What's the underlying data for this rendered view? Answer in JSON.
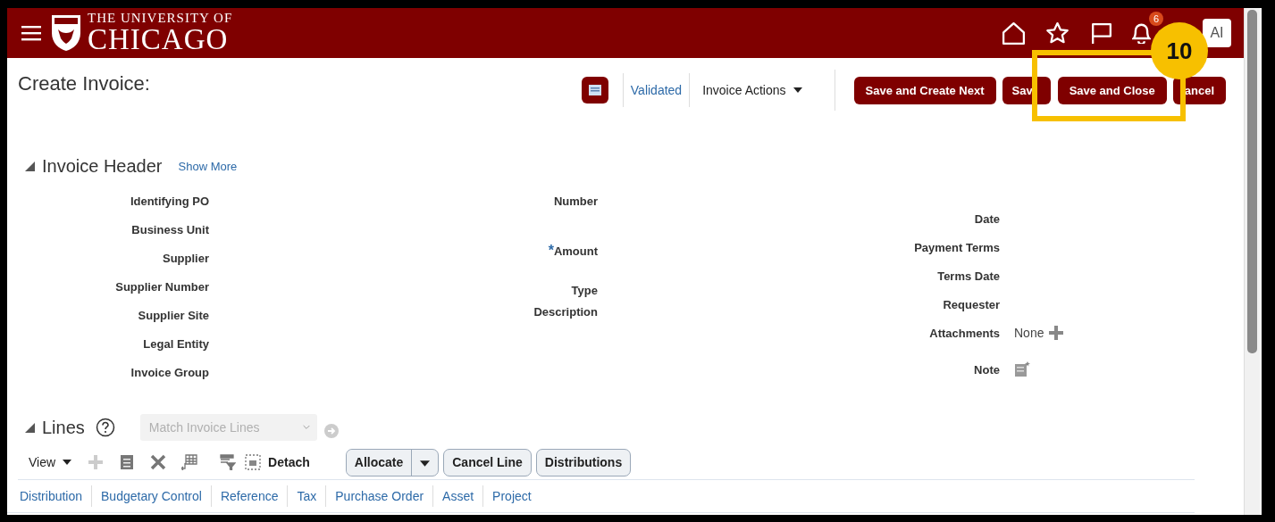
{
  "header": {
    "brand_top": "THE UNIVERSITY OF",
    "brand_main": "CHICAGO",
    "notification_count": "6",
    "avatar": "AI"
  },
  "page": {
    "title": "Create Invoice:",
    "status": "Validated",
    "actions_menu": "Invoice Actions",
    "buttons": [
      {
        "label": "Save and Create Next"
      },
      {
        "label": "Sav"
      },
      {
        "label": "Save and Close"
      },
      {
        "label": "ancel"
      }
    ]
  },
  "callout": {
    "number": "10"
  },
  "invoice_header": {
    "title": "Invoice Header",
    "expanded": true,
    "link": "Show More",
    "columns": [
      [
        {
          "label": "Identifying PO",
          "kind": "text"
        },
        {
          "label": "Business Unit",
          "kind": "text"
        },
        {
          "label": "Supplier",
          "kind": "text"
        },
        {
          "label": "Supplier Number",
          "kind": "text"
        },
        {
          "label": "Supplier Site",
          "kind": "text"
        },
        {
          "label": "Legal Entity",
          "kind": "text"
        },
        {
          "label": "Invoice Group",
          "kind": "text"
        }
      ],
      [
        {
          "label": "Number",
          "kind": "text"
        },
        {
          "label": "Amount",
          "marker": "*",
          "kind": "text"
        },
        {
          "label": "Type",
          "kind": "text"
        },
        {
          "label": "Description",
          "kind": "text"
        }
      ],
      [
        {
          "label": "Date",
          "kind": "text"
        },
        {
          "label": "Payment Terms",
          "kind": "text"
        },
        {
          "label": "Terms Date",
          "kind": "text"
        },
        {
          "label": "Requester",
          "kind": "text"
        },
        {
          "label": "Attachments",
          "kind": "attachments",
          "value": "None"
        },
        {
          "label": "Note",
          "kind": "note"
        }
      ]
    ]
  },
  "lines": {
    "title": "Lines",
    "expanded": true,
    "match_placeholder": "Match Invoice Lines",
    "view_menu": "View",
    "tools": [
      {
        "kind": "add",
        "disabled": true
      },
      {
        "kind": "copy",
        "disabled": false
      },
      {
        "kind": "delete",
        "disabled": false
      },
      {
        "kind": "split",
        "disabled": false
      },
      {
        "kind": "filter",
        "disabled": false
      },
      {
        "kind": "detach",
        "disabled": false,
        "label": "Detach"
      }
    ],
    "buttons": [
      {
        "label": "Allocate",
        "kind": "split"
      },
      {
        "label": "Cancel Line",
        "kind": "plain"
      },
      {
        "label": "Distributions",
        "kind": "plain"
      }
    ],
    "tabs": [
      "Distribution",
      "Budgetary Control",
      "Reference",
      "Tax",
      "Purchase Order",
      "Asset",
      "Project"
    ]
  }
}
